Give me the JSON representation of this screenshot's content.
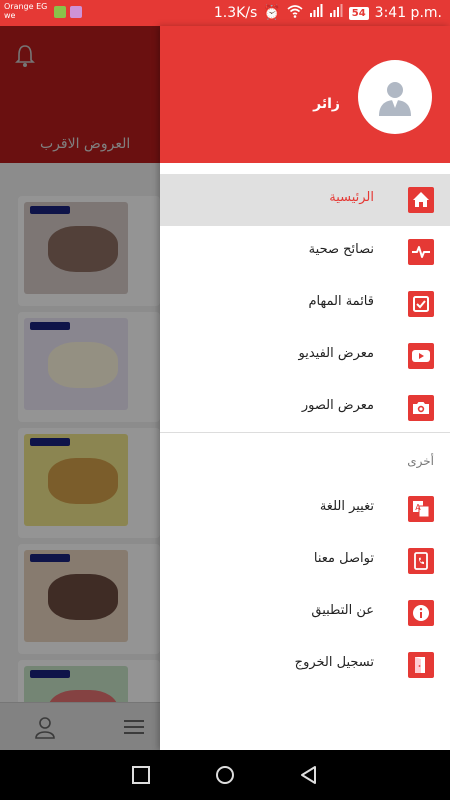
{
  "status_bar": {
    "carrier_line1": "Orange EG",
    "carrier_line2": "we",
    "network_speed": "1.3K/s",
    "battery": "54",
    "time": "3:41 p.m."
  },
  "background_app": {
    "offers_title": "العروض الاقرب"
  },
  "drawer": {
    "user_name": "زائر",
    "menu_items": [
      {
        "label": "الرئيسية",
        "icon": "home-icon",
        "active": true
      },
      {
        "label": "نصائح صحية",
        "icon": "heartbeat-icon",
        "active": false
      },
      {
        "label": "قائمة المهام",
        "icon": "checkbox-icon",
        "active": false
      },
      {
        "label": "معرض الفيديو",
        "icon": "video-icon",
        "active": false
      },
      {
        "label": "معرض الصور",
        "icon": "camera-icon",
        "active": false
      }
    ],
    "section_other": "أخرى",
    "other_items": [
      {
        "label": "تغيير اللغة",
        "icon": "translate-icon"
      },
      {
        "label": "تواصل معنا",
        "icon": "contact-icon"
      },
      {
        "label": "عن التطبيق",
        "icon": "info-icon"
      },
      {
        "label": "تسجيل الخروج",
        "icon": "logout-icon"
      }
    ]
  },
  "colors": {
    "accent": "#e53935",
    "accent_dark": "#b71c1c",
    "active_row": "#e0e0e0"
  }
}
